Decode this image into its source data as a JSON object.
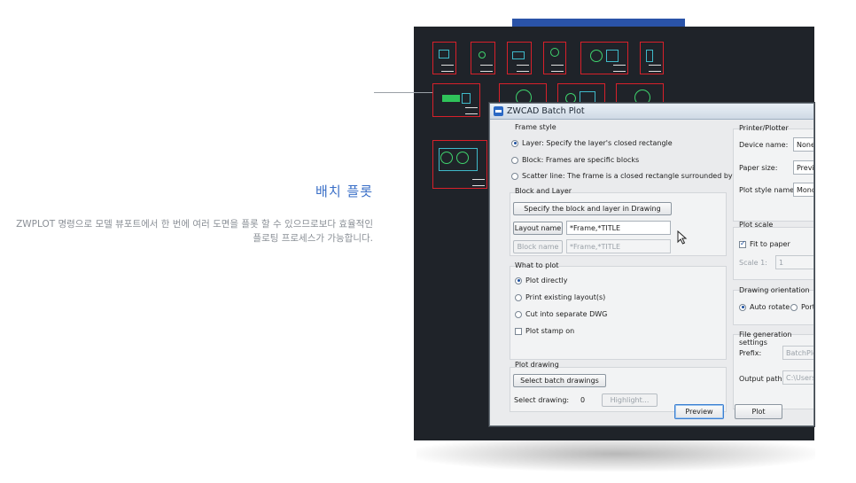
{
  "feature": {
    "title": "배치 플롯",
    "description": "ZWPLOT 명령으로 모델 뷰포트에서 한 번에 여러 도면을 플롯 할 수 있으므로보다 효율적인 플로팅 프로세스가 가능합니다."
  },
  "dialog": {
    "title": "ZWCAD Batch Plot",
    "frame_style": {
      "label": "Frame style",
      "options": [
        {
          "label": "Layer: Specify the layer's closed rectangle",
          "selected": true
        },
        {
          "label": "Block: Frames are specific blocks",
          "selected": false
        },
        {
          "label": "Scatter line: The frame is a closed rectangle surrounded by lines",
          "selected": false
        }
      ]
    },
    "block_layer": {
      "label": "Block and Layer",
      "specify_button": "Specify the block and layer in Drawing",
      "layout_name_button": "Layout name",
      "layout_name_value": "*Frame,*TITLE",
      "block_name_button": "Block name",
      "block_name_value": "*Frame,*TITLE"
    },
    "what_to_plot": {
      "label": "What to plot",
      "options": [
        {
          "label": "Plot directly",
          "selected": true
        },
        {
          "label": "Print existing layout(s)",
          "selected": false
        },
        {
          "label": "Cut into separate DWG",
          "selected": false
        }
      ],
      "stamp_label": "Plot stamp on",
      "stamp_checked": false
    },
    "plot_drawing": {
      "label": "Plot drawing",
      "select_button": "Select batch drawings",
      "select_label": "Select drawing:",
      "count": "0",
      "highlight_button": "Highlight..."
    },
    "printer": {
      "label": "Printer/Plotter",
      "device_label": "Device name:",
      "device_value": "None",
      "paper_label": "Paper size:",
      "paper_value": "Previo",
      "style_label": "Plot style name:",
      "style_value": "Mono"
    },
    "plot_scale": {
      "label": "Plot scale",
      "fit_label": "Fit to paper",
      "fit_checked": true,
      "scale_label": "Scale 1:",
      "scale_value": "1"
    },
    "orientation": {
      "label": "Drawing orientation",
      "auto_label": "Auto rotate",
      "auto_selected": true,
      "portrait_label": "Port"
    },
    "file_gen": {
      "label": "File generation settings",
      "prefix_label": "Prefix:",
      "prefix_value": "BatchPlo",
      "output_label": "Output path:",
      "output_value": "C:\\Users\\"
    },
    "preview_button": "Preview",
    "plot_button": "Plot"
  },
  "colors": {
    "accent": "#3a6fc7",
    "cad_background": "#1f2329",
    "frame_red": "#d8202a",
    "header_blue": "#2a53a8"
  }
}
